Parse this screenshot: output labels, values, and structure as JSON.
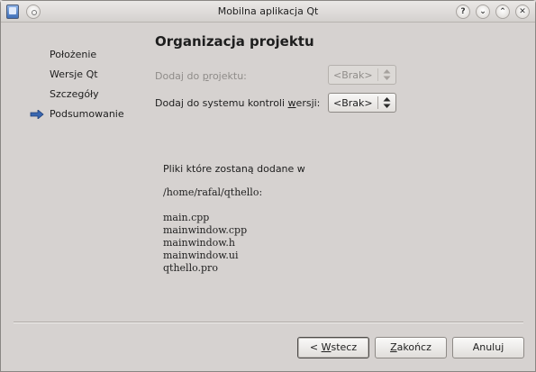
{
  "window": {
    "title": "Mobilna aplikacja Qt",
    "controls": [
      "?",
      "⌄",
      "⌃",
      "✕"
    ]
  },
  "sidebar": {
    "items": [
      {
        "label": "Położenie"
      },
      {
        "label": "Wersje Qt"
      },
      {
        "label": "Szczegóły"
      },
      {
        "label": "Podsumowanie",
        "current": true
      }
    ]
  },
  "main": {
    "title": "Organizacja projektu",
    "add_to_project": {
      "label_prefix": "Dodaj do ",
      "label_underlined": "p",
      "label_suffix": "rojektu:",
      "value": "<Brak>",
      "enabled": false
    },
    "add_to_vcs": {
      "label_prefix": "Dodaj do systemu kontroli ",
      "label_underlined": "w",
      "label_suffix": "ersji:",
      "value": "<Brak>",
      "enabled": true
    },
    "info_text": "Pliki które zostaną dodane w",
    "path": "/home/rafal/qthello:",
    "files": [
      "main.cpp",
      "mainwindow.cpp",
      "mainwindow.h",
      "mainwindow.ui",
      "qthello.pro"
    ]
  },
  "buttons": {
    "back": {
      "prefix": "< ",
      "underlined": "W",
      "suffix": "stecz"
    },
    "finish": {
      "prefix": "",
      "underlined": "Z",
      "suffix": "akończ"
    },
    "cancel": {
      "label": "Anuluj"
    }
  },
  "colors": {
    "window_bg": "#d6d2d0",
    "arrow_accent": "#3a67b0"
  }
}
